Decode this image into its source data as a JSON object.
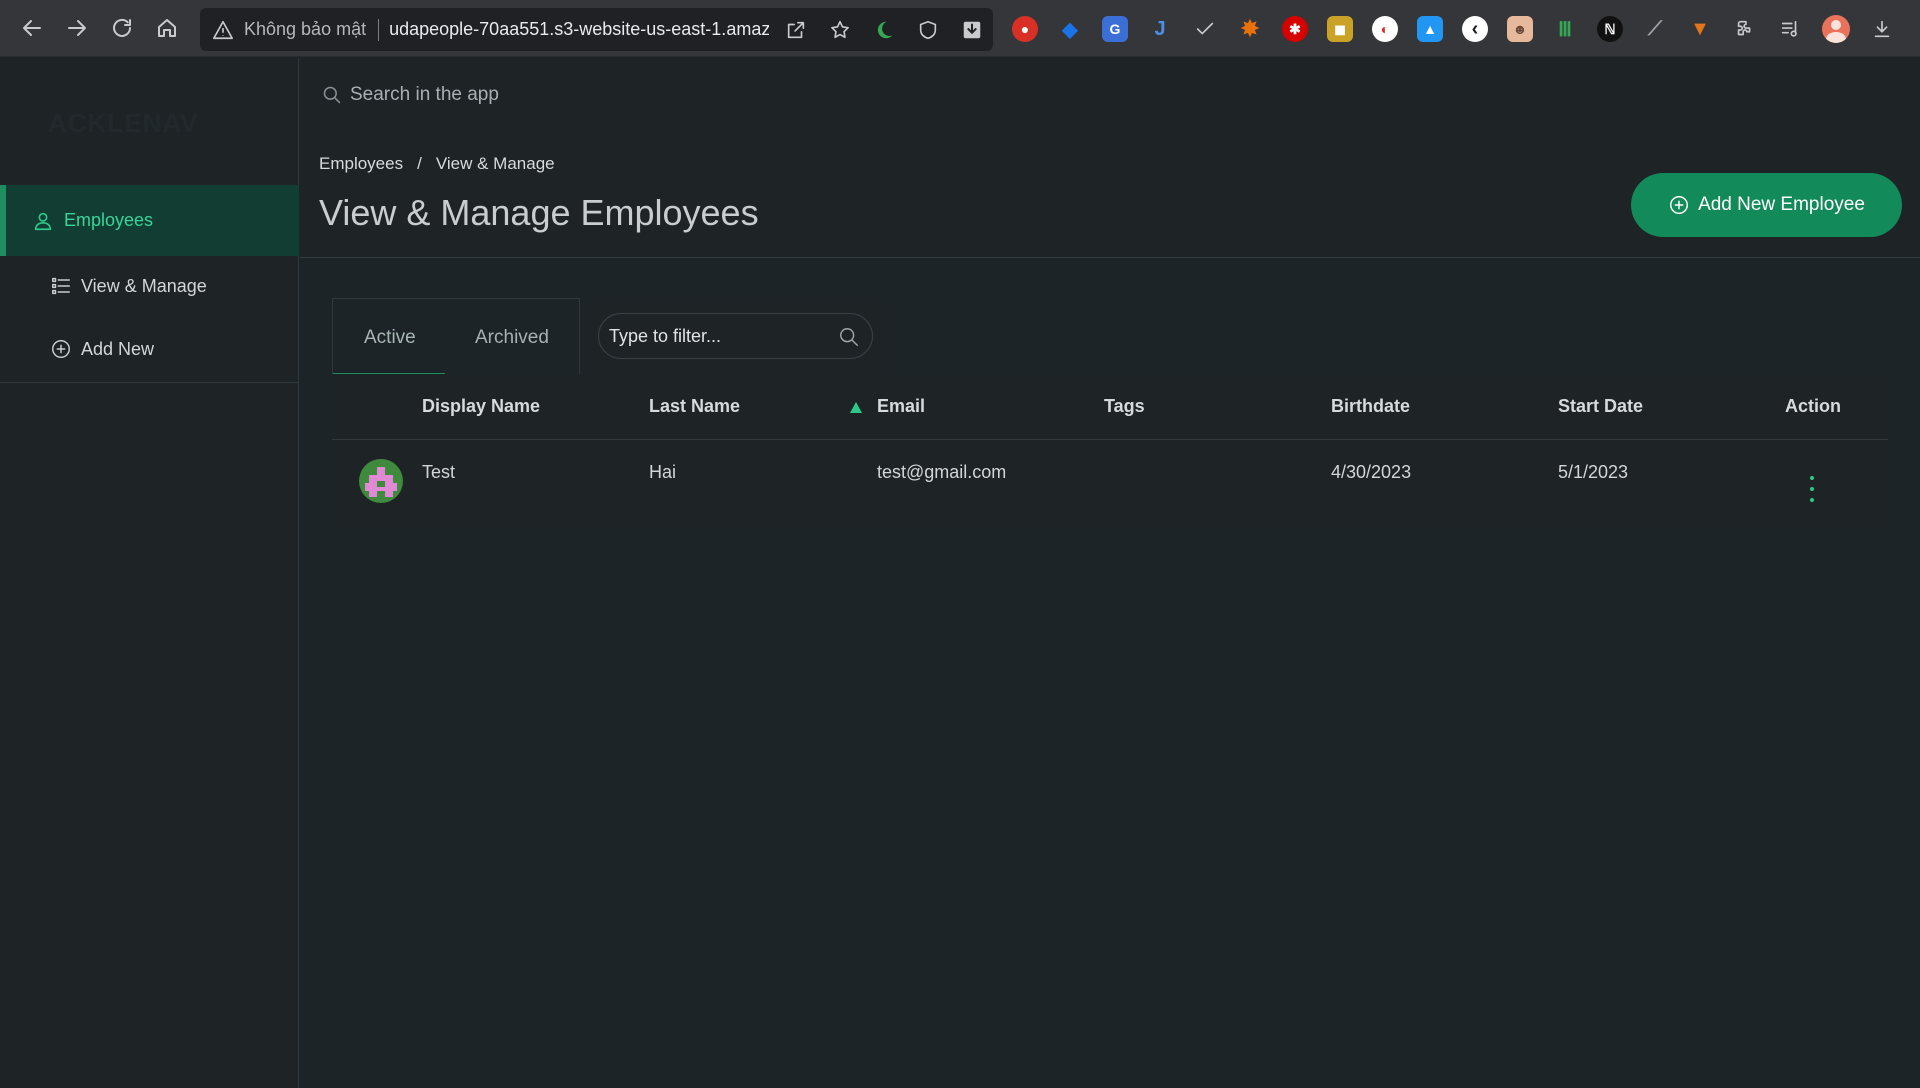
{
  "browser": {
    "security_label": "Không bảo mật",
    "url": "udapeople-70aa551.s3-website-us-east-1.amaz..."
  },
  "extensions": [
    {
      "icon": "adblock-icon",
      "color": "#d93025",
      "glyph": "●"
    },
    {
      "icon": "gem-icon",
      "color": "#1a73e8",
      "glyph": "◆"
    },
    {
      "icon": "translate-icon",
      "color": "#3b6fd6",
      "glyph": "G"
    },
    {
      "icon": "jira-icon",
      "color": "#1d4fa8",
      "glyph": "J"
    },
    {
      "icon": "check-icon",
      "color": "#5f6368",
      "glyph": "✓"
    },
    {
      "icon": "fire-icon",
      "color": "#e8710a",
      "glyph": "✸"
    },
    {
      "icon": "red-star-icon",
      "color": "#d50000",
      "glyph": "✱"
    },
    {
      "icon": "palette-icon",
      "color": "#c9a227",
      "glyph": "◼"
    },
    {
      "icon": "compass-icon",
      "color": "#ffffff",
      "glyph": "◐"
    },
    {
      "icon": "drop-icon",
      "color": "#2196f3",
      "glyph": "▲"
    },
    {
      "icon": "back-circle-icon",
      "color": "#ffffff",
      "glyph": "‹"
    },
    {
      "icon": "face-icon",
      "color": "#e6b89c",
      "glyph": "☻"
    },
    {
      "icon": "mint-icon",
      "color": "#34a853",
      "glyph": "Ⅲ"
    },
    {
      "icon": "notion-icon",
      "color": "#111111",
      "glyph": "ℕ"
    },
    {
      "icon": "feather-icon",
      "color": "#5f6368",
      "glyph": "⟋"
    },
    {
      "icon": "metamask-icon",
      "color": "#e2761b",
      "glyph": "▼"
    }
  ],
  "sidebar": {
    "logo_text": "ACKLENAV",
    "main_item": "Employees",
    "items": [
      {
        "label": "View & Manage"
      },
      {
        "label": "Add New"
      }
    ]
  },
  "search": {
    "placeholder": "Search in the app"
  },
  "header": {
    "breadcrumb": [
      "Employees",
      "/",
      "View & Manage"
    ],
    "title": "View & Manage Employees",
    "add_button": "Add New Employee"
  },
  "tabs": [
    {
      "label": "Active",
      "active": true
    },
    {
      "label": "Archived",
      "active": false
    }
  ],
  "filter": {
    "placeholder": "Type to filter..."
  },
  "table": {
    "columns": [
      "Display Name",
      "Last Name",
      "Email",
      "Tags",
      "Birthdate",
      "Start Date",
      "Action"
    ],
    "sort_column": "Email",
    "rows": [
      {
        "display_name": "Test",
        "last_name": "Hai",
        "email": "test@gmail.com",
        "tags": "",
        "birthdate": "4/30/2023",
        "start_date": "5/1/2023"
      }
    ]
  },
  "colors": {
    "accent": "#128a59",
    "accent_text": "#39d49a",
    "background": "#1c2428",
    "panel": "#1e2326"
  }
}
